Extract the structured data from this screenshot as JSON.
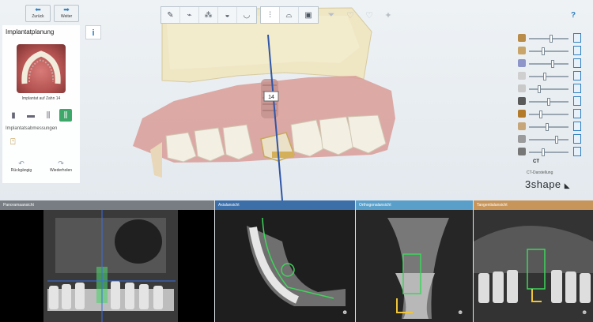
{
  "nav": {
    "back_label": "Zurück",
    "next_label": "Weiter"
  },
  "toolbar": {
    "tools": [
      "scan-tool-icon",
      "bite-tool-icon",
      "teeth-tool-icon",
      "crown-tool-icon",
      "prep-tool-icon",
      "implant-tool-icon",
      "sleeve-tool-icon",
      "guide-tool-icon",
      "funnel-tool-icon",
      "tooth-outline-icon",
      "tooth-shell-icon",
      "settings-icon"
    ],
    "active_tool": "implant-tool-icon"
  },
  "left_panel": {
    "title": "Implantatplanung",
    "info_label": "i",
    "thumbnail_caption": "Implantat auf Zahn 14",
    "implant_icons": [
      "implant-type-1-icon",
      "implant-type-2-icon",
      "implant-type-3-icon",
      "implant-type-4-icon"
    ],
    "active_implant_icon": "implant-type-4-icon",
    "dimensions_label": "Implantatsabmessungen",
    "undo_label": "Rückgängig",
    "redo_label": "Wiederholen"
  },
  "viewport": {
    "tooth_number": "14",
    "colors": {
      "bone": "#efe6c4",
      "gingiva": "#d99c98",
      "teeth": "#f3efe3",
      "implant_axis": "#2f56a8",
      "abutment": "#d4b05a"
    }
  },
  "right_panel": {
    "help_label": "?",
    "sliders": [
      {
        "name": "scan-visibility",
        "level": 0.55
      },
      {
        "name": "jaw-visibility",
        "level": 0.35
      },
      {
        "name": "bone-visibility",
        "level": 0.6
      },
      {
        "name": "gingiva-visibility",
        "level": 0.4
      },
      {
        "name": "nerve-visibility",
        "level": 0.25
      },
      {
        "name": "implant-visibility",
        "level": 0.5
      },
      {
        "name": "sleeve-visibility",
        "level": 0.3
      },
      {
        "name": "tooth-visibility",
        "level": 0.45
      },
      {
        "name": "guide-visibility",
        "level": 0.7
      },
      {
        "name": "wax-visibility",
        "level": 0.35
      }
    ],
    "ct_label": "CT",
    "ct_view_label": "CT-Darstellung",
    "logo_text": "3shape"
  },
  "ct_views": [
    {
      "title": "Panoramaansicht",
      "color": "#777d82"
    },
    {
      "title": "Axialansicht",
      "color": "#3c6ea8"
    },
    {
      "title": "Orthogonalansicht",
      "color": "#5a9fc9"
    },
    {
      "title": "Tangentialansicht",
      "color": "#c7955a"
    }
  ]
}
